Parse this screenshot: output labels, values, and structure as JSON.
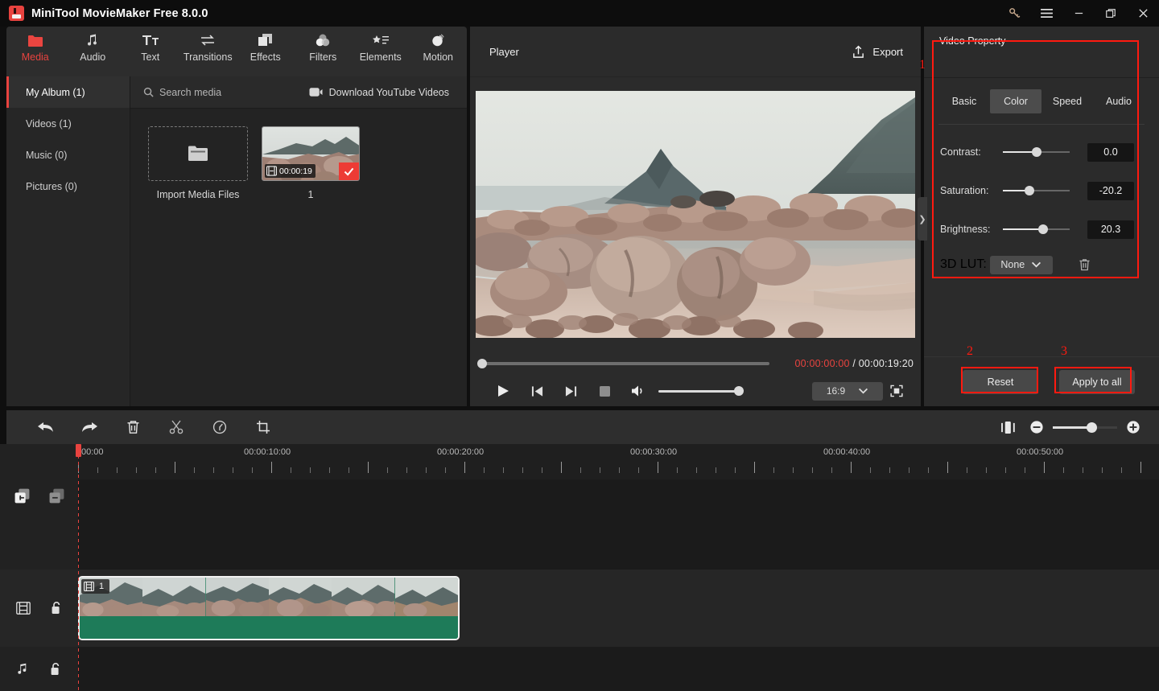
{
  "window": {
    "title": "MiniTool MovieMaker Free 8.0.0",
    "controls": [
      {
        "name": "key-icon",
        "label": "Register"
      },
      {
        "name": "menu-icon",
        "label": "Menu"
      },
      {
        "name": "minimize-icon",
        "label": "Minimize"
      },
      {
        "name": "maximize-icon",
        "label": "Maximize"
      },
      {
        "name": "close-icon",
        "label": "Close"
      }
    ]
  },
  "tabbar": {
    "tabs": [
      {
        "label": "Media",
        "icon": "folder-icon",
        "active": true
      },
      {
        "label": "Audio",
        "icon": "music-note-icon",
        "active": false
      },
      {
        "label": "Text",
        "icon": "text-icon",
        "active": false
      },
      {
        "label": "Transitions",
        "icon": "transitions-arrows-icon",
        "active": false
      },
      {
        "label": "Effects",
        "icon": "effects-squares-icon",
        "active": false
      },
      {
        "label": "Filters",
        "icon": "filters-circles-icon",
        "active": false
      },
      {
        "label": "Elements",
        "icon": "elements-star-list-icon",
        "active": false
      },
      {
        "label": "Motion",
        "icon": "motion-circle-icon",
        "active": false
      }
    ]
  },
  "library": {
    "albums": [
      {
        "label": "My Album (1)",
        "active": true
      },
      {
        "label": "Videos (1)",
        "active": false
      },
      {
        "label": "Music (0)",
        "active": false
      },
      {
        "label": "Pictures (0)",
        "active": false
      }
    ],
    "search_placeholder": "Search media",
    "download_label": "Download YouTube Videos",
    "import_label": "Import Media Files",
    "media_items": [
      {
        "caption": "1",
        "duration": "00:00:19",
        "selected": true
      }
    ]
  },
  "player": {
    "title": "Player",
    "export_label": "Export",
    "current_time": "00:00:00:00",
    "separator": "/",
    "total_time": "00:00:19:20",
    "aspect_ratio": "16:9",
    "seek_progress_pct": 0,
    "volume_pct": 100,
    "buttons": [
      {
        "name": "play-button",
        "label": "Play"
      },
      {
        "name": "previous-frame-button",
        "label": "Previous"
      },
      {
        "name": "next-frame-button",
        "label": "Next"
      },
      {
        "name": "stop-button",
        "label": "Stop"
      },
      {
        "name": "volume-button",
        "label": "Volume"
      }
    ]
  },
  "property": {
    "title": "Video Property",
    "tabs": [
      {
        "label": "Basic",
        "active": false
      },
      {
        "label": "Color",
        "active": true
      },
      {
        "label": "Speed",
        "active": false
      },
      {
        "label": "Audio",
        "active": false
      }
    ],
    "rows": [
      {
        "label": "Contrast:",
        "value": "0.0",
        "knob_pct": 50
      },
      {
        "label": "Saturation:",
        "value": "-20.2",
        "knob_pct": 40
      },
      {
        "label": "Brightness:",
        "value": "20.3",
        "knob_pct": 60
      }
    ],
    "lut": {
      "label": "3D LUT:",
      "value": "None",
      "delete_icon": "trash-icon"
    },
    "reset_label": "Reset",
    "apply_all_label": "Apply to all"
  },
  "annotations": [
    {
      "number": "1",
      "target": "video-property-panel"
    },
    {
      "number": "2",
      "target": "reset-button"
    },
    {
      "number": "3",
      "target": "apply-to-all-button"
    }
  ],
  "timeline": {
    "toolbar": [
      {
        "name": "undo-button",
        "label": "Undo"
      },
      {
        "name": "redo-button",
        "label": "Redo"
      },
      {
        "name": "delete-button",
        "label": "Delete"
      },
      {
        "name": "split-button",
        "label": "Split"
      },
      {
        "name": "speed-button",
        "label": "Speed"
      },
      {
        "name": "crop-button",
        "label": "Crop"
      }
    ],
    "zoom_controls": [
      {
        "name": "fit-timeline-button",
        "label": "Fit to timeline"
      },
      {
        "name": "zoom-out-button",
        "label": "Zoom out"
      },
      {
        "name": "zoom-in-button",
        "label": "Zoom in"
      }
    ],
    "zoom_pct": 55,
    "ruler_labels": [
      "00:00",
      "00:00:10:00",
      "00:00:20:00",
      "00:00:30:00",
      "00:00:40:00",
      "00:00:50:00"
    ],
    "playhead_time": "00:00",
    "tracks": [
      {
        "name": "video-track",
        "icons": [
          "film-icon",
          "unlock-icon"
        ]
      },
      {
        "name": "audio-track",
        "icons": [
          "music-note-icon",
          "unlock-icon"
        ]
      }
    ],
    "clip": {
      "label": "1",
      "badge_icon": "film-icon"
    }
  }
}
